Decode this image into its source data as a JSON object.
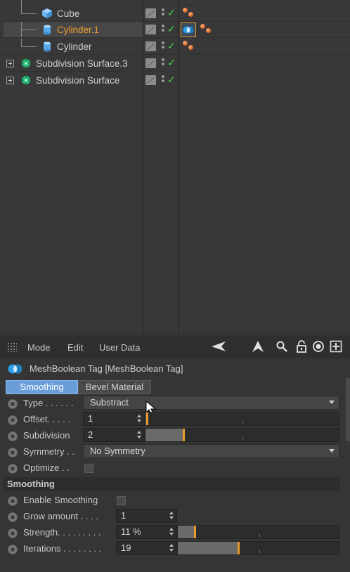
{
  "object_manager": {
    "rows": [
      {
        "label": "Cube",
        "icon": "cube-icon"
      },
      {
        "label": "Cylinder.1",
        "icon": "cylinder-icon",
        "selected": true
      },
      {
        "label": "Cylinder",
        "icon": "cylinder-icon"
      },
      {
        "label": "Subdivision Surface.3",
        "icon": "subdivision-surface-icon"
      },
      {
        "label": "Subdivision Surface",
        "icon": "subdivision-surface-icon"
      }
    ],
    "check_mark": "✓"
  },
  "attribute_manager": {
    "menu": {
      "mode": "Mode",
      "edit": "Edit",
      "user_data": "User Data"
    },
    "tag_title": "MeshBoolean Tag [MeshBoolean Tag]",
    "tabs": [
      {
        "label": "Smoothing",
        "active": true
      },
      {
        "label": "Bevel Material",
        "active": false
      }
    ],
    "params": {
      "type": {
        "label": "Type . . . . . .",
        "value": "Substract"
      },
      "offset": {
        "label": "Offset. . . . .",
        "value": "1",
        "slider_fraction": 0.01
      },
      "subdivision": {
        "label": "Subdivision",
        "value": "2",
        "slider_fraction": 0.2
      },
      "symmetry": {
        "label": "Symmetry . .",
        "value": "No Symmetry"
      },
      "optimize": {
        "label": "Optimize . .",
        "checked": false
      }
    },
    "smoothing_section": {
      "title": "Smoothing",
      "enable": {
        "label": "Enable Smoothing",
        "checked": false
      },
      "grow_amount": {
        "label": "Grow amount . . . .",
        "value": "1"
      },
      "strength": {
        "label": "Strength. . . . . . . . .",
        "value": "11 %",
        "slider_fraction": 0.11
      },
      "iterations": {
        "label": "Iterations . . . . . . . .",
        "value": "19",
        "slider_fraction": 0.38
      }
    }
  },
  "colors": {
    "accent_blue": "#6a9ed8",
    "selected_text": "#f0a030",
    "check_green": "#44d14a",
    "slider_knob": "#e89a2a"
  }
}
